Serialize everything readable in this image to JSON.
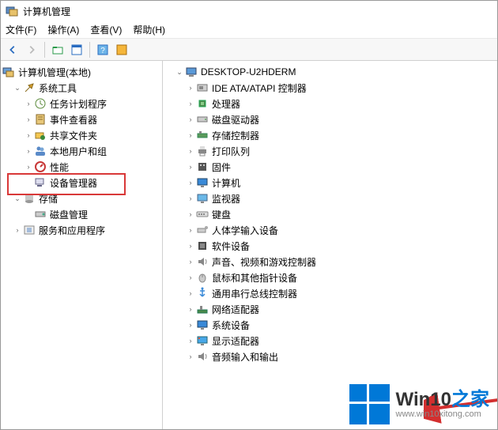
{
  "window": {
    "title": "计算机管理"
  },
  "menu": {
    "file": "文件(F)",
    "action": "操作(A)",
    "view": "查看(V)",
    "help": "帮助(H)"
  },
  "left_tree": {
    "root": "计算机管理(本地)",
    "system_tools": "系统工具",
    "system_tools_children": {
      "task_scheduler": "任务计划程序",
      "event_viewer": "事件查看器",
      "shared_folders": "共享文件夹",
      "local_users": "本地用户和组",
      "performance": "性能",
      "device_manager": "设备管理器"
    },
    "storage": "存储",
    "storage_children": {
      "disk_mgmt": "磁盘管理"
    },
    "services": "服务和应用程序"
  },
  "right_tree": {
    "root": "DESKTOP-U2HDERM",
    "nodes": {
      "ide": "IDE ATA/ATAPI 控制器",
      "cpu": "处理器",
      "disk": "磁盘驱动器",
      "storage_ctrl": "存储控制器",
      "print": "打印队列",
      "firmware": "固件",
      "computer": "计算机",
      "monitor": "监视器",
      "keyboard": "键盘",
      "hid": "人体学输入设备",
      "software": "软件设备",
      "sound": "声音、视频和游戏控制器",
      "mouse": "鼠标和其他指针设备",
      "usb": "通用串行总线控制器",
      "network": "网络适配器",
      "sysdev": "系统设备",
      "display": "显示适配器",
      "audio_io": "音频输入和输出"
    }
  },
  "watermark": {
    "brand_main": "Win10",
    "brand_suffix": "之家",
    "url": "www.win10xitong.com"
  }
}
